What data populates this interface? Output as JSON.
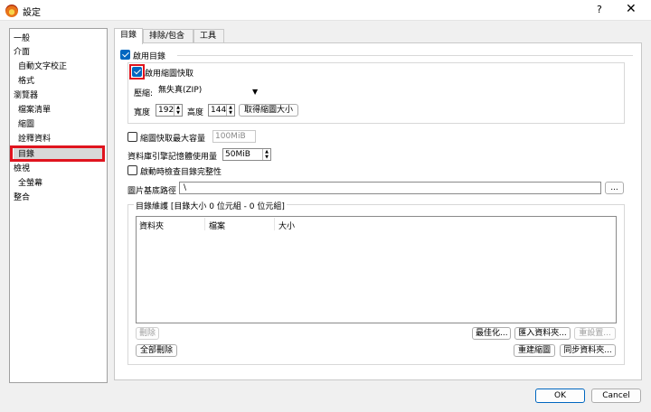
{
  "window": {
    "title": "設定",
    "help_label": "?",
    "close_label": "✕",
    "app_icon": "flame-icon"
  },
  "sidebar": {
    "items": [
      {
        "label": "一般"
      },
      {
        "label": "介面"
      },
      {
        "label": "自動文字校正"
      },
      {
        "label": "格式"
      },
      {
        "label": "瀏覽器"
      },
      {
        "label": "檔案清單"
      },
      {
        "label": "縮圖"
      },
      {
        "label": "詮釋資料"
      },
      {
        "label": "目錄"
      },
      {
        "label": "檢視"
      },
      {
        "label": "全螢幕"
      },
      {
        "label": "整合"
      }
    ],
    "selected_label": "目錄"
  },
  "tabs": [
    {
      "label": "目錄"
    },
    {
      "label": "排除/包含"
    },
    {
      "label": "工具"
    }
  ],
  "catalog": {
    "enable_label": "啟用目錄",
    "enable_checked": true,
    "thumb_cache_label": "啟用縮圖快取",
    "thumb_cache_checked": true,
    "compression_label": "壓縮:",
    "compression_value": "無失真(ZIP)",
    "width_label": "寬度",
    "width_value": "192",
    "height_label": "高度",
    "height_value": "144",
    "get_size_button": "取得縮圖大小",
    "max_cache_label": "縮圖快取最大容量",
    "max_cache_checked": false,
    "max_cache_value": "100MiB",
    "db_memory_label": "資料庫引擎記憶體使用量",
    "db_memory_value": "50MiB",
    "startup_check_label": "啟動時檢查目錄完整性",
    "startup_check_checked": false,
    "base_path_label": "圖片基底路徑",
    "base_path_value": "\\",
    "browse_button": "...",
    "maintenance_label": "目錄維護 [目錄大小 0 位元組 - 0 位元組]",
    "columns": [
      "資料夾",
      "檔案",
      "大小"
    ],
    "rows": [],
    "delete_button": "刪除",
    "optimize_button": "最佳化...",
    "import_folder_button": "匯入資料夾...",
    "reset_button": "重設置...",
    "delete_all_button": "全部刪除",
    "rebuild_thumbs_button": "重建縮圖",
    "sync_folder_button": "同步資料夾..."
  },
  "dialog": {
    "ok_label": "OK",
    "cancel_label": "Cancel"
  },
  "colors": {
    "accent": "#0067c0",
    "highlight_red": "#e0141e"
  }
}
